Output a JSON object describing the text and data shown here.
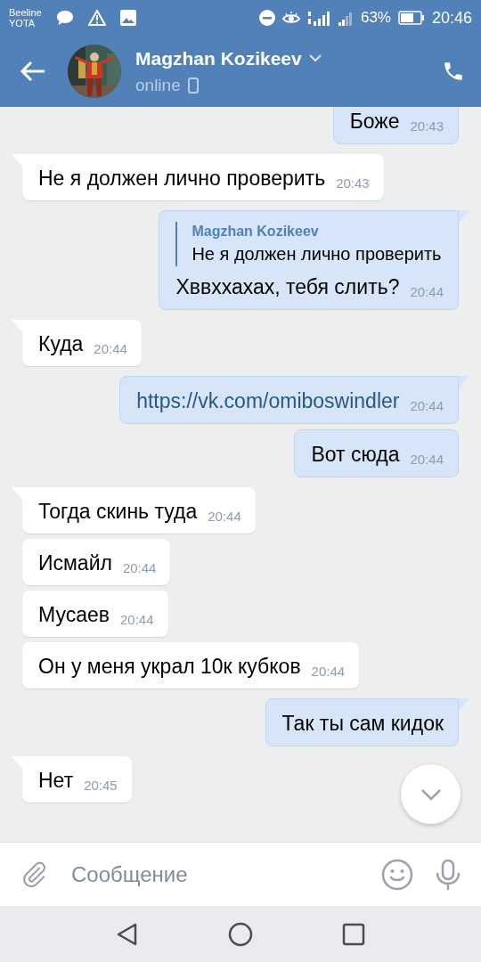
{
  "status_bar": {
    "carriers": [
      "Beeline",
      "YOTA"
    ],
    "battery": "63%",
    "time": "20:46"
  },
  "header": {
    "name": "Magzhan Kozikeev",
    "status": "online"
  },
  "messages": [
    {
      "outgoing": true,
      "kind": "text",
      "text": "Боже",
      "time": "20:43"
    },
    {
      "outgoing": false,
      "kind": "text",
      "text": "Не я должен лично проверить",
      "time": "20:43"
    },
    {
      "outgoing": true,
      "kind": "reply",
      "author": "Magzhan Kozikeev",
      "quote": "Не я должен лично проверить",
      "text": "Хввххахах, тебя слить?",
      "time": "20:44"
    },
    {
      "outgoing": false,
      "kind": "text",
      "text": "Куда",
      "time": "20:44"
    },
    {
      "outgoing": true,
      "kind": "link",
      "text": "https://vk.com/omiboswindler",
      "time": "20:44"
    },
    {
      "outgoing": true,
      "kind": "text",
      "text": "Вот сюда",
      "time": "20:44"
    },
    {
      "outgoing": false,
      "kind": "text",
      "text": "Тогда скинь туда",
      "time": "20:44"
    },
    {
      "outgoing": false,
      "kind": "text",
      "text": "Исмайл",
      "time": "20:44"
    },
    {
      "outgoing": false,
      "kind": "text",
      "text": "Мусаев",
      "time": "20:44"
    },
    {
      "outgoing": false,
      "kind": "text",
      "text": "Он у меня украл 10к кубков",
      "time": "20:44"
    },
    {
      "outgoing": true,
      "kind": "text",
      "text": "Так ты сам кидок"
    },
    {
      "outgoing": false,
      "kind": "text",
      "text": "Нет",
      "time": "20:45"
    }
  ],
  "composer": {
    "placeholder": "Сообщение"
  }
}
